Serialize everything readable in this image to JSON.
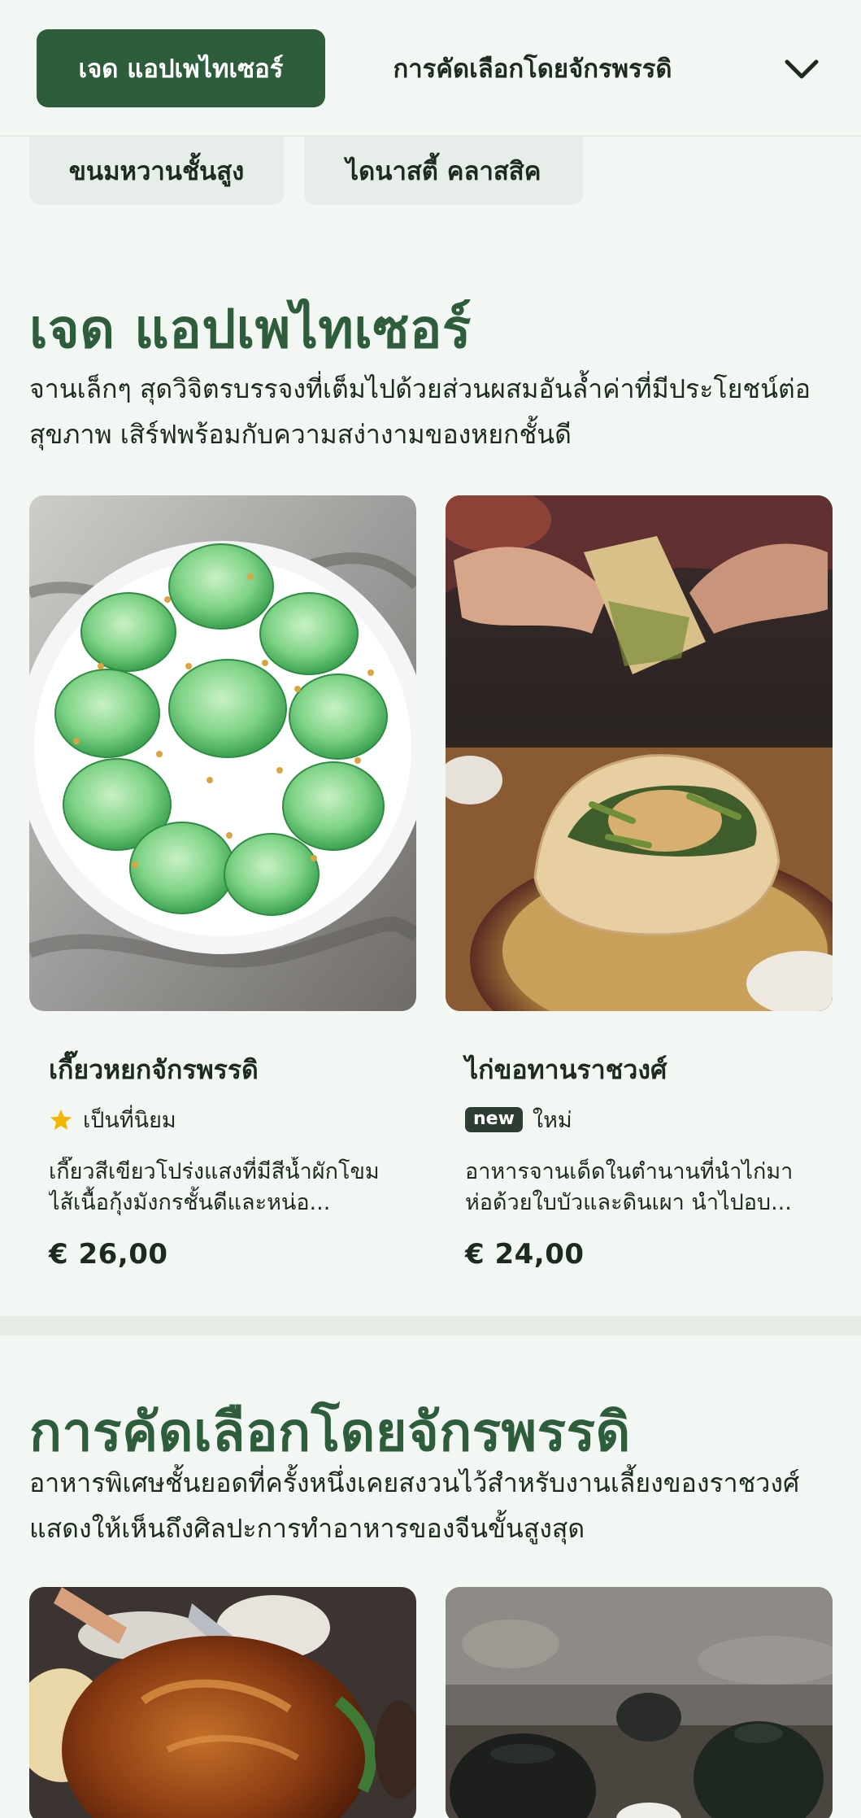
{
  "nav": {
    "tabs": [
      {
        "label": "เจด แอปเพไทเซอร์",
        "active": true
      },
      {
        "label": "การคัดเลือกโดยจักรพรรดิ",
        "active": false
      }
    ],
    "expand_icon": "chevron-down-icon"
  },
  "chips": [
    "ขนมหวานชั้นสูง",
    "ไดนาสตี้ คลาสสิค"
  ],
  "sections": [
    {
      "title": "เจด  แอปเพไทเซอร์",
      "description": "จานเล็กๆ สุดวิจิตรบรรจงที่เต็มไปด้วยส่วนผสมอันล้ำค่าที่มีประโยชน์ต่อสุขภาพ เสิร์ฟพร้อมกับความสง่างามของหยกชั้นดี",
      "items": [
        {
          "name": "เกี๊ยวหยกจักรพรรดิ",
          "badge_icon": "star-icon",
          "badge_label": "เป็นที่นิยม",
          "description": "เกี๊ยวสีเขียวโปร่งแสงที่มีสีน้ำผักโขม ไส้เนื้อกุ้งมังกรชั้นดีและหน่อ...",
          "price": "€ 26,00"
        },
        {
          "name": "ไก่ขอทานราชวงศ์",
          "badge_pill": "new",
          "badge_label": "ใหม่",
          "description": "อาหารจานเด็ดในตำนานที่นำไก่มาห่อด้วยใบบัวและดินเผา นำไปอบ...",
          "price": "€ 24,00"
        }
      ]
    },
    {
      "title": "การคัดเลือกโดยจักรพรรดิ",
      "description": "อาหารพิเศษชั้นยอดที่ครั้งหนึ่งเคยสงวนไว้สำหรับงานเลี้ยงของราชวงศ์ แสดงให้เห็นถึงศิลปะการทำอาหารของจีนขั้นสูงสุด"
    }
  ],
  "colors": {
    "accent": "#2e5d3b",
    "background": "#f3f7f3",
    "chip_bg": "#e7ede8",
    "star": "#f2b705"
  }
}
